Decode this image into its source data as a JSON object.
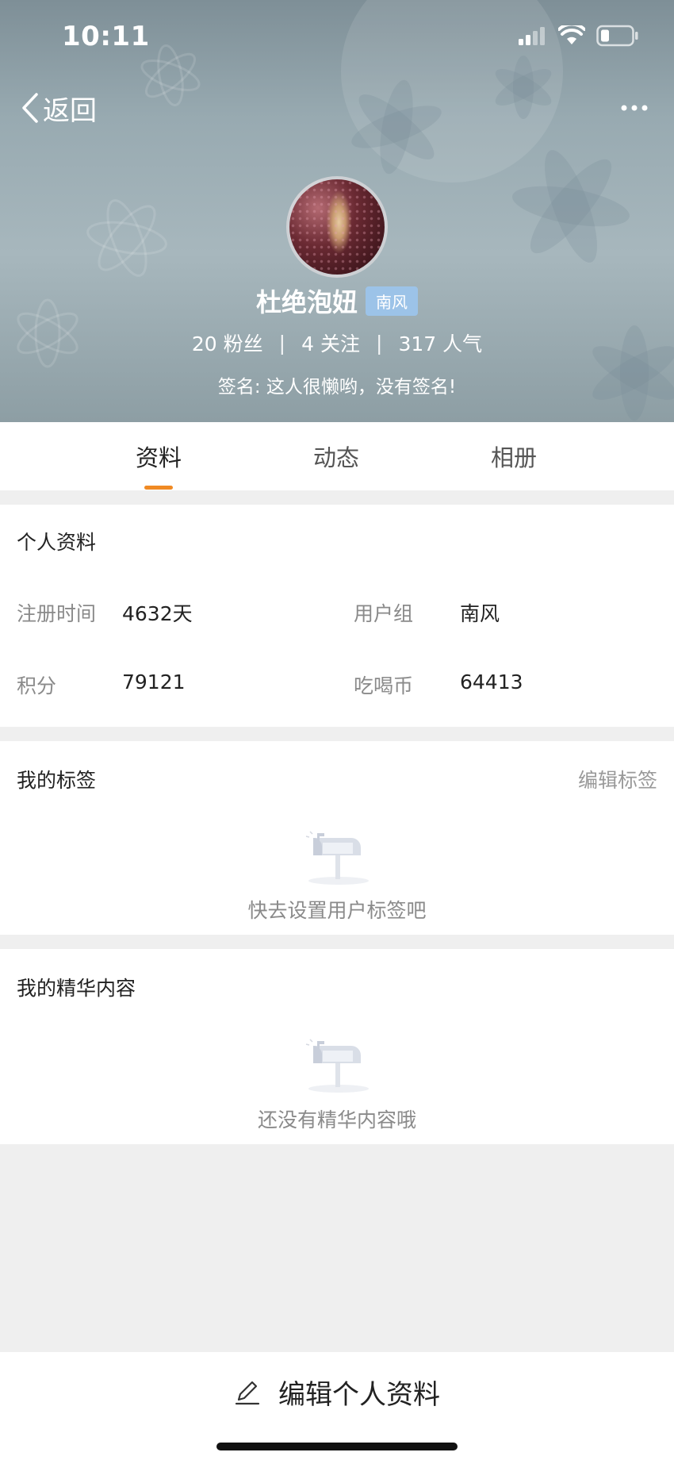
{
  "status_bar": {
    "time": "10:11"
  },
  "nav": {
    "back_label": "返回",
    "more_icon": "more-dots-icon"
  },
  "profile": {
    "username": "杜绝泡妞",
    "group_badge": "南风",
    "followers_count": "20",
    "followers_label": "粉丝",
    "following_count": "4",
    "following_label": "关注",
    "popularity_count": "317",
    "popularity_label": "人气",
    "signature": "签名: 这人很懒哟，没有签名!"
  },
  "tabs": [
    {
      "label": "资料",
      "active": true
    },
    {
      "label": "动态",
      "active": false
    },
    {
      "label": "相册",
      "active": false
    }
  ],
  "personal_info": {
    "title": "个人资料",
    "register_label": "注册时间",
    "register_value": "4632天",
    "group_label": "用户组",
    "group_value": "南风",
    "points_label": "积分",
    "points_value": "79121",
    "coins_label": "吃喝币",
    "coins_value": "64413"
  },
  "tags_section": {
    "title": "我的标签",
    "edit_label": "编辑标签",
    "empty_text": "快去设置用户标签吧"
  },
  "featured_section": {
    "title": "我的精华内容",
    "empty_text": "还没有精华内容哦"
  },
  "bottom": {
    "edit_profile_label": "编辑个人资料"
  },
  "colors": {
    "accent": "#f08a24",
    "badge": "#9cc3e8",
    "header_bg": "#98aab1"
  }
}
